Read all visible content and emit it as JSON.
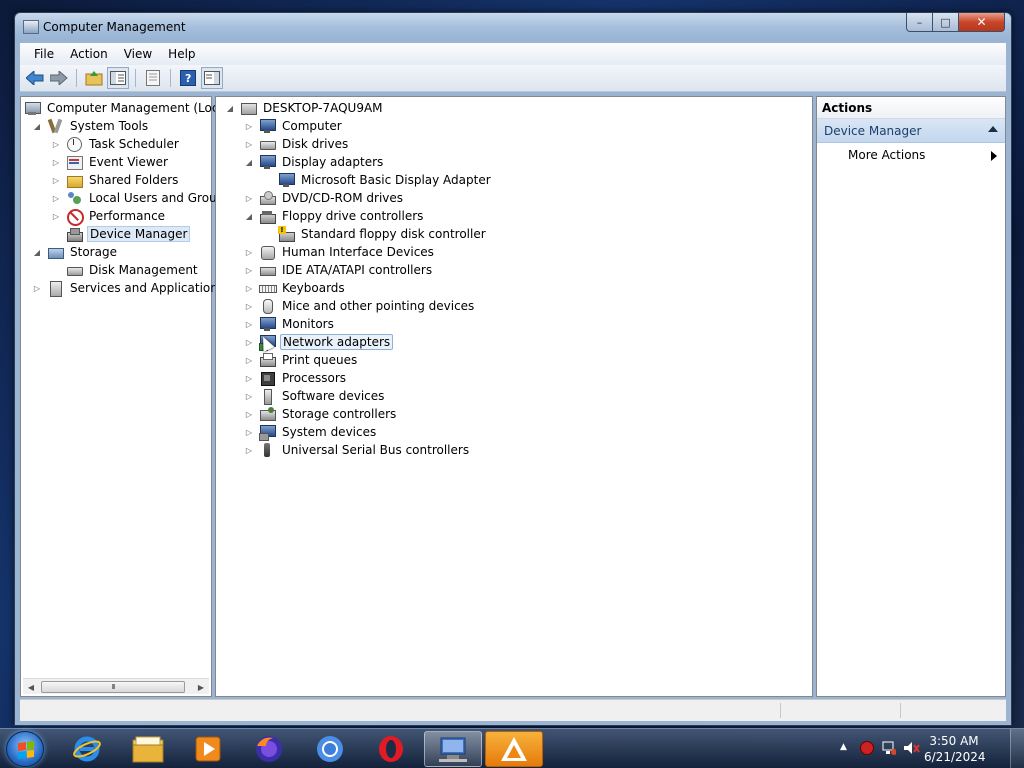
{
  "window": {
    "title": "Computer Management",
    "controls": {
      "minimize": "–",
      "maximize": "□",
      "close": "✕"
    }
  },
  "menu": [
    "File",
    "Action",
    "View",
    "Help"
  ],
  "toolbar": {
    "buttons": [
      "back-arrow-icon",
      "forward-arrow-icon",
      "up-folder-icon",
      "show-hide-tree-icon",
      "properties-icon",
      "help-icon",
      "show-hide-action-pane-icon"
    ]
  },
  "left_tree": {
    "root": "Computer Management (Local",
    "system_tools": "System Tools",
    "task_scheduler": "Task Scheduler",
    "event_viewer": "Event Viewer",
    "shared_folders": "Shared Folders",
    "local_users": "Local Users and Groups",
    "performance": "Performance",
    "device_manager": "Device Manager",
    "storage": "Storage",
    "disk_management": "Disk Management",
    "services_apps": "Services and Applications",
    "scroll_thumb": "III"
  },
  "device_tree": {
    "root": "DESKTOP-7AQU9AM",
    "computer": "Computer",
    "disk_drives": "Disk drives",
    "display_adapters": "Display adapters",
    "ms_basic_display": "Microsoft Basic Display Adapter",
    "dvd": "DVD/CD-ROM drives",
    "floppy_ctrl": "Floppy drive controllers",
    "std_floppy": "Standard floppy disk controller",
    "hid": "Human Interface Devices",
    "ide": "IDE ATA/ATAPI controllers",
    "keyboards": "Keyboards",
    "mice": "Mice and other pointing devices",
    "monitors": "Monitors",
    "network": "Network adapters",
    "print_queues": "Print queues",
    "processors": "Processors",
    "software_devices": "Software devices",
    "storage_ctrl": "Storage controllers",
    "system_devices": "System devices",
    "usb": "Universal Serial Bus controllers"
  },
  "actions": {
    "header": "Actions",
    "group": "Device Manager",
    "more_actions": "More Actions"
  },
  "taskbar": {
    "apps": [
      "internet-explorer-icon",
      "file-explorer-icon",
      "media-player-icon",
      "firefox-icon",
      "chrome-icon",
      "opera-icon",
      "computer-management-icon",
      "avast-icon"
    ],
    "clock_time": "3:50 AM",
    "clock_date": "6/21/2024"
  },
  "colors": {
    "selection": "#dde9f6",
    "actions_group_bg": "#c3d7ef",
    "close_button": "#c8462a"
  }
}
